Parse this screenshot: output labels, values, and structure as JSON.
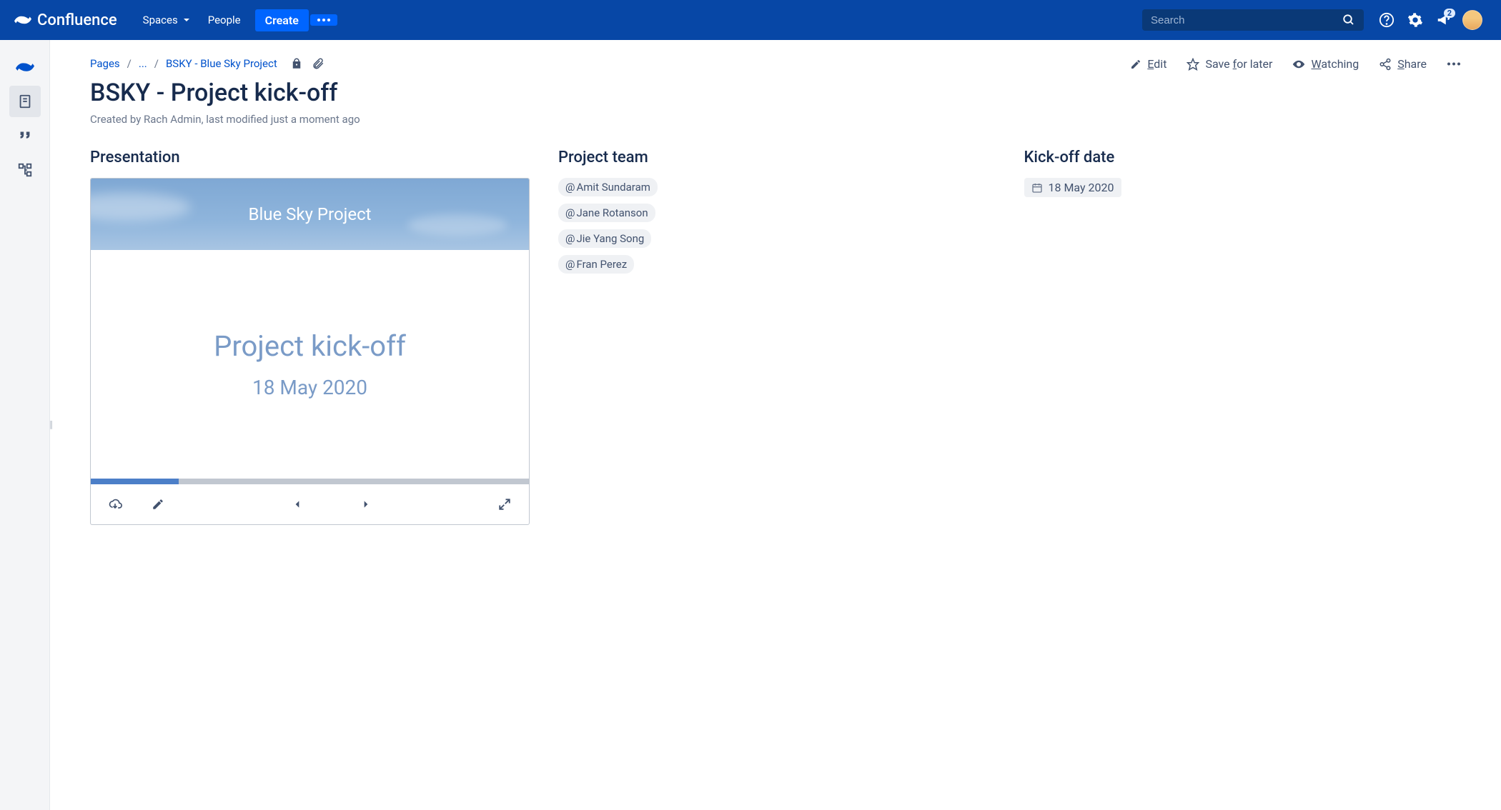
{
  "topnav": {
    "brand": "Confluence",
    "spaces_label": "Spaces",
    "people_label": "People",
    "create_label": "Create",
    "search_placeholder": "Search",
    "notification_count": "2"
  },
  "breadcrumbs": {
    "root": "Pages",
    "ellipsis": "...",
    "parent": "BSKY - Blue Sky Project"
  },
  "page_actions": {
    "edit": "Edit",
    "save_later": "Save for later",
    "watching": "Watching",
    "share": "Share"
  },
  "page": {
    "title": "BSKY - Project kick-off",
    "byline": "Created by Rach Admin, last modified just a moment ago"
  },
  "sections": {
    "presentation": "Presentation",
    "team": "Project team",
    "kickoff": "Kick-off date"
  },
  "slide": {
    "banner": "Blue Sky Project",
    "title": "Project kick-off",
    "date": "18 May 2020"
  },
  "team": [
    "Amit Sundaram",
    "Jane Rotanson",
    "Jie Yang Song",
    "Fran Perez"
  ],
  "kickoff_date": "18 May 2020"
}
